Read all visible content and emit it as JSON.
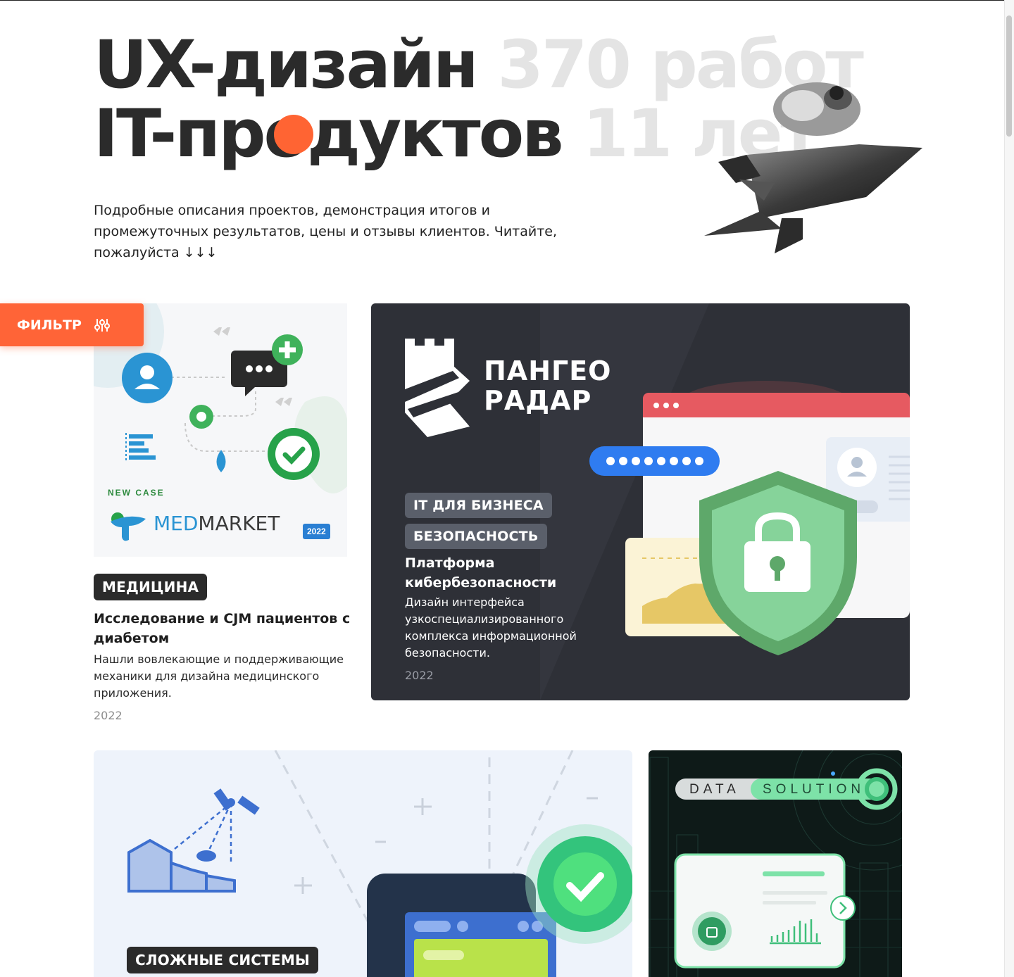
{
  "hero": {
    "title_line1_main": "UX-дизайн",
    "title_line1_stat": "370 работ",
    "title_line2_main": "IT-продуктов",
    "title_line2_stat": "11 лет",
    "subtitle": "Подробные описания проектов, демонстрация итогов и промежуточных результатов, цены и отзывы клиентов. Читайте, пожалуйста ↓↓↓"
  },
  "filter": {
    "label": "ФИЛЬТР",
    "icon": "sliders-icon"
  },
  "cards": {
    "medmarket": {
      "image_caption": "NEW CASE",
      "image_brand_a": "MED",
      "image_brand_b": "MARKET",
      "image_year_badge": "2022",
      "tag": "МЕДИЦИНА",
      "title": "Исследование и CJM пациентов с диабетом",
      "description": "Нашли вовлекающие и поддерживающие механики для дизайна медицинского приложения.",
      "year": "2022"
    },
    "pangeo": {
      "logo_line1": "ПАНГЕО",
      "logo_line2": "РАДАР",
      "tags": [
        "IT ДЛЯ БИЗНЕСА",
        "БЕЗОПАСНОСТЬ"
      ],
      "title": "Платформа кибербезопасности",
      "description": "Дизайн интерфейса узкоспециализированного комплекса информационной безопасности.",
      "year": "2022"
    },
    "satellite": {
      "tag": "СЛОЖНЫЕ СИСТЕМЫ"
    },
    "data_solution": {
      "logo_a": "DATA",
      "logo_b": "SOLUTION"
    }
  },
  "colors": {
    "accent": "#ff6437",
    "dark": "#2b2b2b",
    "muted": "#e4e4e4",
    "pangeo_bg": "#2e3037",
    "green": "#7ccf93"
  }
}
